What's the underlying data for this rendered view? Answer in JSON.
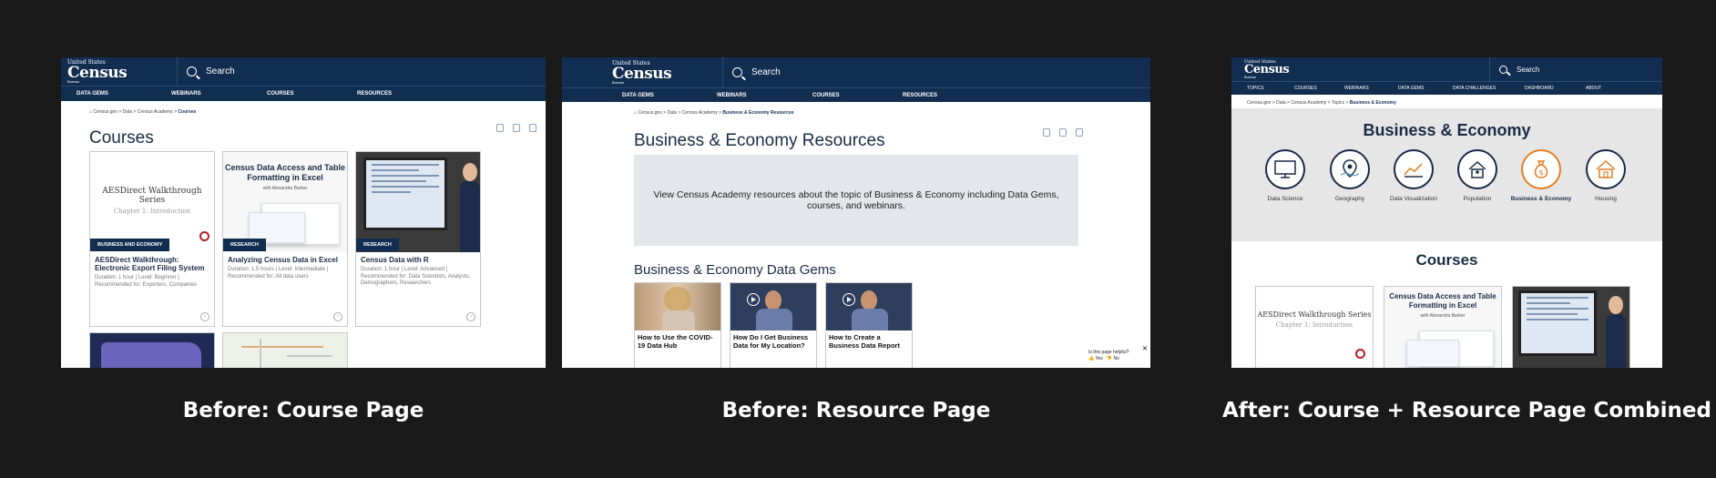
{
  "header": {
    "logo_line1": "United States",
    "logo_line2": "Census",
    "logo_line3": "Bureau",
    "search_placeholder": "Search",
    "nav_before": [
      "DATA GEMS",
      "WEBINARS",
      "COURSES",
      "RESOURCES"
    ],
    "nav_after": [
      "TOPICS",
      "COURSES",
      "WEBINARS",
      "DATA GEMS",
      "DATA CHALLENGES",
      "DASHBOARD",
      "ABOUT"
    ]
  },
  "course_page": {
    "breadcrumb": [
      "Census.gov",
      "Data",
      "Census Academy"
    ],
    "breadcrumb_current": "Courses",
    "title": "Courses",
    "cards": [
      {
        "thumb_title": "AESDirect Walkthrough Series",
        "thumb_subtitle": "Chapter 1: Introduction",
        "tag": "BUSINESS AND ECONOMY",
        "title": "AESDirect Walkthrough: Electronic Export Filing System",
        "meta": "Duration: 1 hour | Level: Beginner | Recommended for: Exporters, Companies"
      },
      {
        "thumb_title": "Census Data Access and Table Formatting in Excel",
        "thumb_subtitle": "with Alexandra Barker",
        "tag": "RESEARCH",
        "title": "Analyzing Census Data in Excel",
        "meta": "Duration: 1.5 hours | Level: Intermediate | Recommended for: All data users"
      },
      {
        "tag": "RESEARCH",
        "title": "Census Data with R",
        "meta": "Duration: 1 hour | Level: Advanced | Recommended for: Data Scientists, Analysts, Demographers, Researchers"
      }
    ]
  },
  "resource_page": {
    "breadcrumb": [
      "Census.gov",
      "Data",
      "Census Academy"
    ],
    "breadcrumb_current": "Business & Economy Resources",
    "title": "Business & Economy Resources",
    "intro": "View Census Academy resources about the topic of Business & Economy including Data Gems, courses, and webinars.",
    "gems_title": "Business & Economy Data Gems",
    "gems": [
      {
        "title": "How to Use the COVID-19 Data Hub"
      },
      {
        "title": "How Do I Get Business Data for My Location?"
      },
      {
        "title": "How to Create a Business Data Report"
      }
    ],
    "helpful_question": "Is this page helpful?",
    "helpful_yes": "Yes",
    "helpful_no": "No"
  },
  "combined_page": {
    "breadcrumb": "Census.gov > Data > Census Academy > Topics >",
    "breadcrumb_current": "Business & Economy",
    "title": "Business & Economy",
    "topics": [
      "Data Science",
      "Geography",
      "Data Visualization",
      "Population",
      "Business & Economy",
      "Housing"
    ],
    "active_topic": "Business & Economy",
    "courses_title": "Courses",
    "card_aes_title": "AESDirect Walkthrough Series",
    "card_aes_subtitle": "Chapter 1: Introduction",
    "card_excel_title": "Census Data Access and Table Formatting in Excel",
    "card_excel_subtitle": "with Alexandra Barker"
  },
  "captions": {
    "before_course": "Before: Course Page",
    "before_resource": "Before: Resource Page",
    "after": "After: Course + Resource Page Combined"
  },
  "colors": {
    "navy": "#112e51",
    "accent_orange": "#e67e22",
    "panel_gray": "#e3e6ea",
    "background": "#1a1a1a"
  }
}
